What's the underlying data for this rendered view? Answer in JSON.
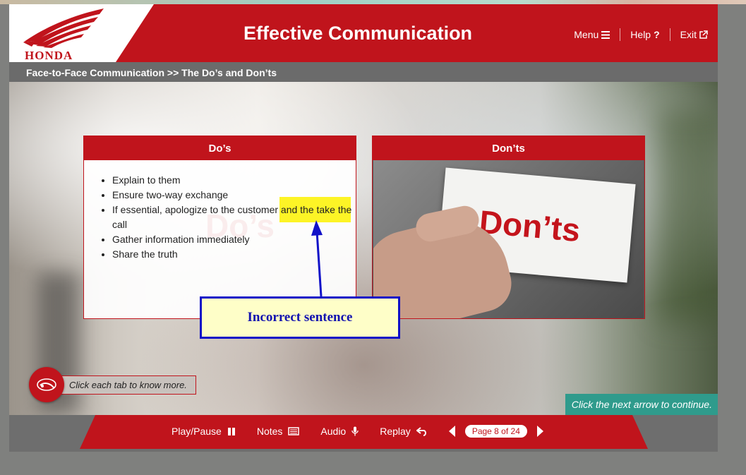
{
  "brand": {
    "logo_text": "HONDA",
    "color": "#c0141c"
  },
  "header": {
    "title": "Effective Communication"
  },
  "topnav": {
    "menu": "Menu",
    "help": "Help",
    "exit": "Exit"
  },
  "breadcrumb": "Face-to-Face Communication >> The Do’s and Don’ts",
  "dos_panel": {
    "heading": "Do’s",
    "watermark": "Do’s",
    "items": [
      "Explain to them",
      "Ensure two-way exchange",
      "If essential, apologize to the customer and the take the call",
      "Gather information immediately",
      "Share the truth"
    ]
  },
  "donts_panel": {
    "heading": "Don’ts",
    "card_text": "Don’ts"
  },
  "annotation": {
    "callout": "Incorrect sentence",
    "color": "#1212b0",
    "highlight_color": "#fdf200"
  },
  "tip": {
    "text": "Click each tab to know more."
  },
  "next_hint": "Click the next arrow to continue.",
  "controls": {
    "play_pause": "Play/Pause",
    "notes": "Notes",
    "audio": "Audio",
    "replay": "Replay",
    "page_indicator": "Page 8 of 24"
  },
  "icons": [
    "menu-icon",
    "help-icon",
    "exit-icon",
    "pause-icon",
    "notes-icon",
    "mic-icon",
    "replay-icon",
    "prev-arrow-icon",
    "next-arrow-icon",
    "touch-icon"
  ]
}
